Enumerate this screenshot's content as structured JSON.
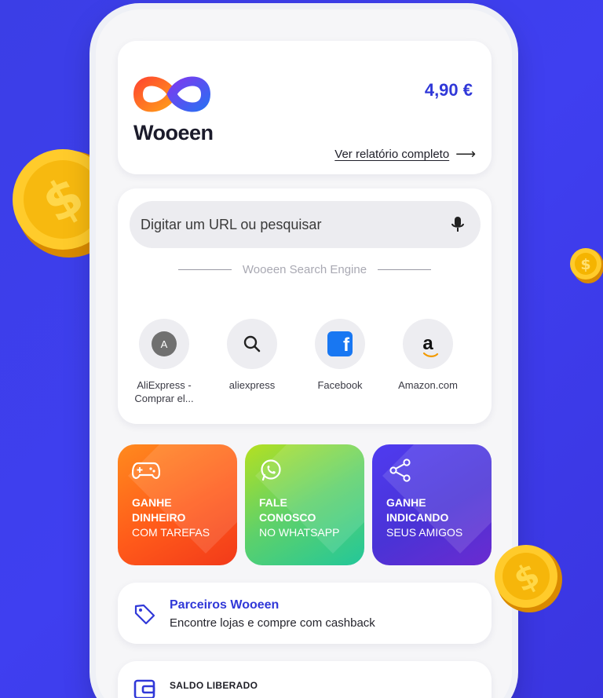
{
  "header": {
    "brand": "Wooeen",
    "balance": "4,90 €",
    "report_link": "Ver relatório completo",
    "arrow_icon": "arrow-right-icon"
  },
  "search": {
    "placeholder": "Digitar um URL ou pesquisar",
    "mic_icon": "microphone-icon",
    "engine_label": "Wooeen Search Engine"
  },
  "shortcuts": [
    {
      "label": "AliExpress - Comprar el...",
      "icon": "aliexpress-letter-icon",
      "badge": "A"
    },
    {
      "label": "aliexpress",
      "icon": "search-icon"
    },
    {
      "label": "Facebook",
      "icon": "facebook-icon",
      "badge": "f"
    },
    {
      "label": "Amazon.com",
      "icon": "amazon-icon",
      "badge": "a"
    }
  ],
  "tiles": [
    {
      "line1": "GANHE",
      "line2": "DINHEIRO",
      "line3": "COM TAREFAS",
      "icon": "gamepad-icon",
      "color": "#ff5a1a"
    },
    {
      "line1": "FALE",
      "line2": "CONOSCO",
      "line3": "NO WHATSAPP",
      "icon": "whatsapp-icon",
      "color": "#3cc87a"
    },
    {
      "line1": "GANHE",
      "line2": "INDICANDO",
      "line3": "SEUS AMIGOS",
      "icon": "share-icon",
      "color": "#4a33d6"
    }
  ],
  "partners": {
    "title": "Parceiros Wooeen",
    "subtitle": "Encontre lojas e compre com cashback",
    "icon": "tag-icon"
  },
  "balance_section": {
    "title": "SALDO LIBERADO",
    "icon": "wallet-icon"
  },
  "colors": {
    "background": "#3f3ff0",
    "accent": "#3038d8",
    "coin": "#f5b800"
  }
}
